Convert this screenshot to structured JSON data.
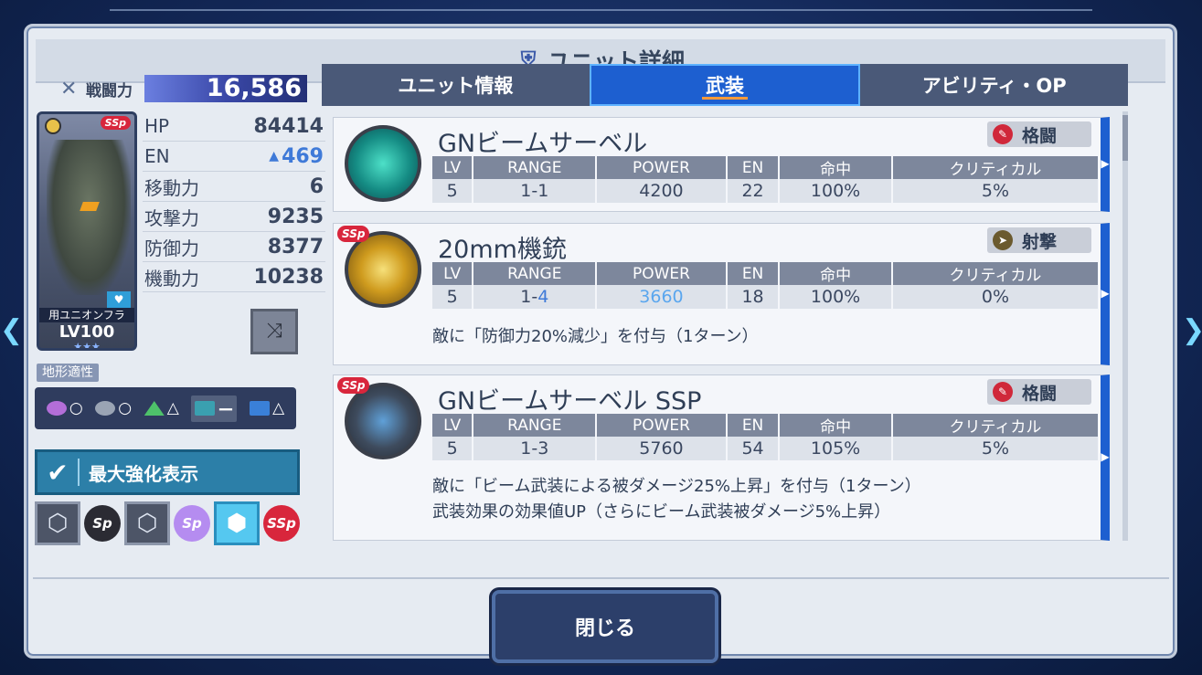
{
  "title": "ユニット詳細",
  "power": {
    "label": "戦闘力",
    "value": "16,586"
  },
  "unit": {
    "rank": "SSp",
    "name": "用ユニオンフラ",
    "level": "LV100",
    "stars": "★★★"
  },
  "stats": [
    {
      "label": "HP",
      "value": "84414"
    },
    {
      "label": "EN",
      "value": "469"
    },
    {
      "label": "移動力",
      "value": "6"
    },
    {
      "label": "攻撃力",
      "value": "9235"
    },
    {
      "label": "防御力",
      "value": "8377"
    },
    {
      "label": "機動力",
      "value": "10238"
    }
  ],
  "terrain": {
    "label": "地形適性",
    "items": [
      {
        "icon": "space-icon",
        "grade": "○",
        "color": "#b36ed8"
      },
      {
        "icon": "air-icon",
        "grade": "○",
        "color": "#9aa4b4"
      },
      {
        "icon": "ground-icon",
        "grade": "△",
        "color": "#4ec26a"
      },
      {
        "icon": "water-icon",
        "grade": "ー",
        "color": "#3aa0b0"
      },
      {
        "icon": "underground-icon",
        "grade": "△",
        "color": "#3a80d8"
      }
    ]
  },
  "max_display": {
    "label": "最大強化表示"
  },
  "slot_badges": [
    "Sp",
    "Sp",
    "SSp"
  ],
  "tabs": [
    {
      "label": "ユニット情報",
      "active": false
    },
    {
      "label": "武装",
      "active": true
    },
    {
      "label": "アビリティ・OP",
      "active": false
    }
  ],
  "table_headers": [
    "LV",
    "RANGE",
    "POWER",
    "EN",
    "命中",
    "クリティカル"
  ],
  "weapons": [
    {
      "name": "GNビームサーベル",
      "type": "格闘",
      "ssp": false,
      "lv": "5",
      "range": "1-1",
      "power": "4200",
      "en": "22",
      "hit": "100%",
      "crit": "5%",
      "desc": []
    },
    {
      "name": "20mm機銃",
      "type": "射撃",
      "ssp": true,
      "lv": "5",
      "range_a": "1-",
      "range_b": "4",
      "power": "3660",
      "en": "18",
      "hit": "100%",
      "crit": "0%",
      "desc": [
        "敵に「防御力20%減少」を付与（1ターン）"
      ]
    },
    {
      "name": "GNビームサーベル SSP",
      "type": "格闘",
      "ssp": true,
      "lv": "5",
      "range": "1-3",
      "power": "5760",
      "en": "54",
      "hit": "105%",
      "crit": "5%",
      "desc": [
        "敵に「ビーム武装による被ダメージ25%上昇」を付与（1ターン）",
        "武装効果の効果値UP（さらにビーム武装被ダメージ5%上昇）"
      ]
    }
  ],
  "close_label": "閉じる",
  "ssp_label": "SSp"
}
